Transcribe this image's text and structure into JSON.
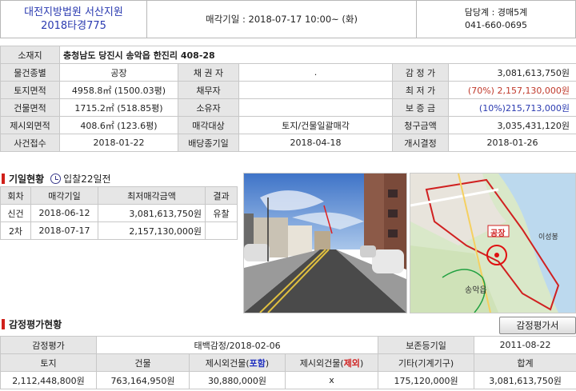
{
  "header": {
    "court": "대전지방법원 서산지원",
    "case_no": "2018타경775",
    "auction_date": "매각기일 : 2018-07-17   10:00~ (화)",
    "dept": "담당계 : 경매5계",
    "phone": "041-660-0695"
  },
  "info": {
    "address_label": "소재지",
    "address": "충청남도 당진시 송악읍 한진리 408-28",
    "rows": [
      {
        "l1": "물건종별",
        "v1": "공장",
        "l2": "채 권 자",
        "v2": ".",
        "l3": "감 정 가",
        "v3": "3,081,613,750원"
      },
      {
        "l1": "토지면적",
        "v1": "4958.8㎡ (1500.03평)",
        "l2": "채무자",
        "v2": "",
        "l3": "최 저 가",
        "v3": "(70%) 2,157,130,000원"
      },
      {
        "l1": "건물면적",
        "v1": "1715.2㎡ (518.85평)",
        "l2": "소유자",
        "v2": "",
        "l3": "보 증 금",
        "v3": "(10%)215,713,000원"
      },
      {
        "l1": "제시외면적",
        "v1": "408.6㎡ (123.6평)",
        "l2": "매각대상",
        "v2": "토지/건물일괄매각",
        "l3": "청구금액",
        "v3": "3,035,431,120원"
      },
      {
        "l1": "사건접수",
        "v1": "2018-01-22",
        "l2": "배당종기일",
        "v2": "2018-04-18",
        "l3": "개시결정",
        "v3": "2018-01-26"
      }
    ]
  },
  "history": {
    "title": "기일현황",
    "subtitle": "입찰22일전",
    "headers": [
      "회차",
      "매각기일",
      "최저매각금액",
      "결과"
    ],
    "rows": [
      {
        "round": "신건",
        "date": "2018-06-12",
        "amount": "3,081,613,750원",
        "result": "유찰"
      },
      {
        "round": "2차",
        "date": "2018-07-17",
        "amount": "2,157,130,000원",
        "result": ""
      }
    ]
  },
  "map": {
    "label": "공장",
    "place_1": "송악읍",
    "place_2": "이성봉"
  },
  "appraisal": {
    "title": "감정평가현황",
    "button": "감정평가서",
    "label": "감정평가",
    "agency": "태백감정/2018-02-06",
    "deadline_label": "보존등기일",
    "deadline": "2011-08-22",
    "cols": {
      "land": "토지",
      "building": "건물",
      "extra_incl_pre": "제시외건물(",
      "extra_incl_mark": "포함",
      "extra_excl_pre": "제시외건물(",
      "extra_excl_mark": "제외",
      "paren_close": ")",
      "other": "기타(기계기구)",
      "total": "합계"
    },
    "values": {
      "land": "2,112,448,800원",
      "building": "763,164,950원",
      "extra_incl": "30,880,000원",
      "extra_excl": "x",
      "other": "175,120,000원",
      "total": "3,081,613,750원"
    }
  }
}
